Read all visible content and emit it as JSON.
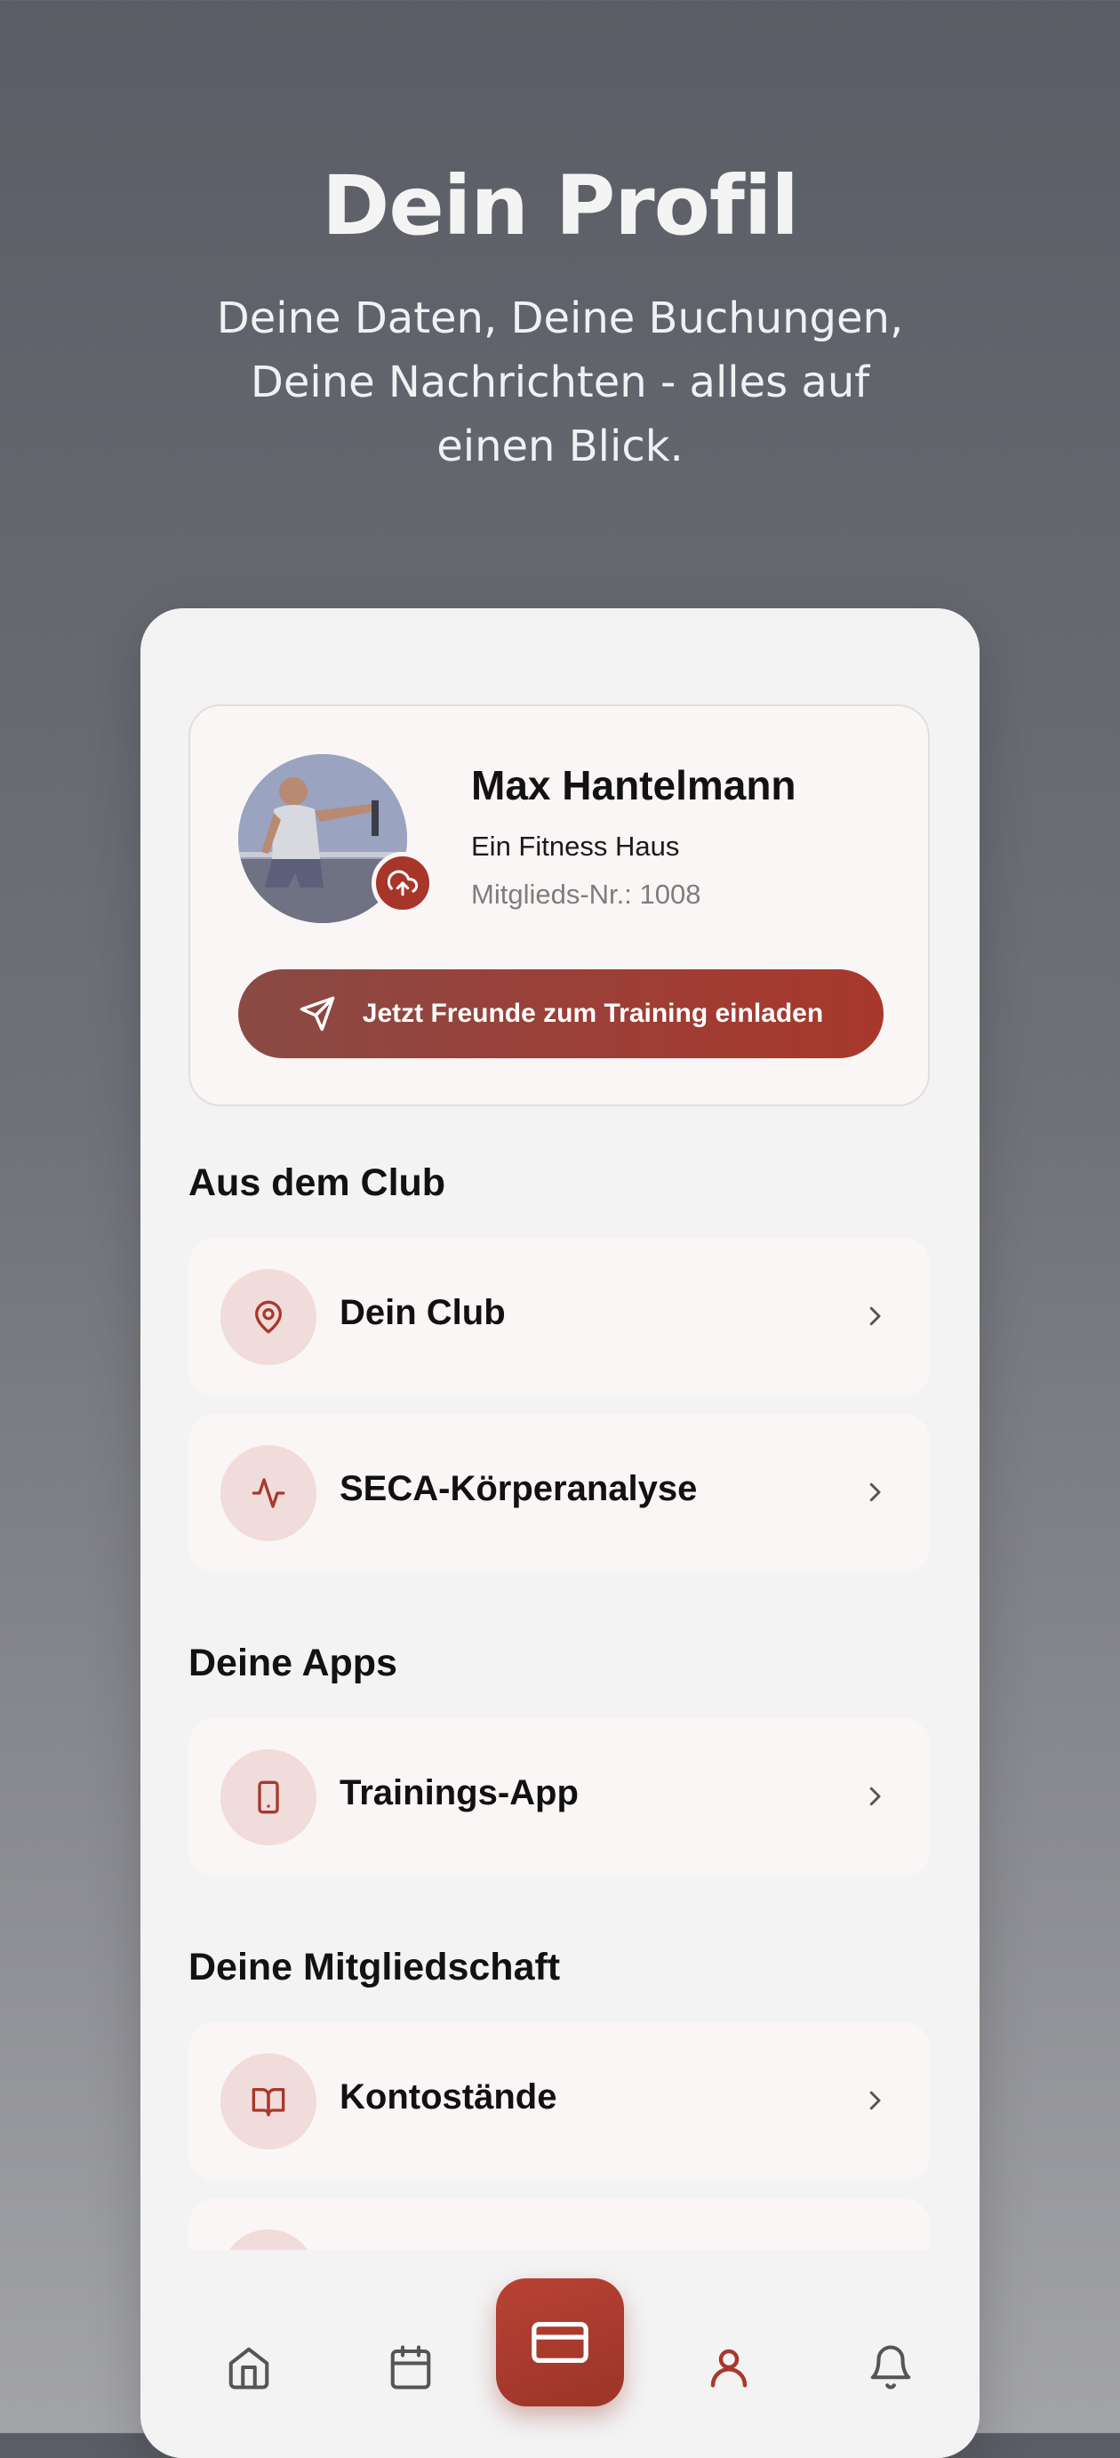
{
  "hero": {
    "title": "Dein Profil",
    "subtitle": "Deine Daten, Deine Buchungen, Deine Nachrichten - alles auf einen Blick."
  },
  "profile": {
    "name": "Max Hantelmann",
    "club": "Ein Fitness Haus",
    "member_number": "Mitglieds-Nr.: 1008",
    "invite_label": "Jetzt Freunde zum Training einladen"
  },
  "sections": {
    "club": {
      "title": "Aus dem Club",
      "items": [
        {
          "label": "Dein Club",
          "icon": "map-pin-icon"
        },
        {
          "label": "SECA-Körperanalyse",
          "icon": "activity-icon"
        }
      ]
    },
    "apps": {
      "title": "Deine Apps",
      "items": [
        {
          "label": "Trainings-App",
          "icon": "smartphone-icon"
        }
      ]
    },
    "membership": {
      "title": "Deine Mitgliedschaft",
      "items": [
        {
          "label": "Kontostände",
          "icon": "book-open-icon"
        }
      ]
    }
  },
  "tabbar": {
    "items": [
      "home-icon",
      "calendar-icon",
      "card-icon",
      "user-icon",
      "bell-icon"
    ],
    "active": "user-icon"
  },
  "colors": {
    "accent": "#a8382c",
    "icon_bg": "#f0dcda",
    "card_bg": "#faf6f5",
    "screen_bg": "#f3f3f4"
  }
}
